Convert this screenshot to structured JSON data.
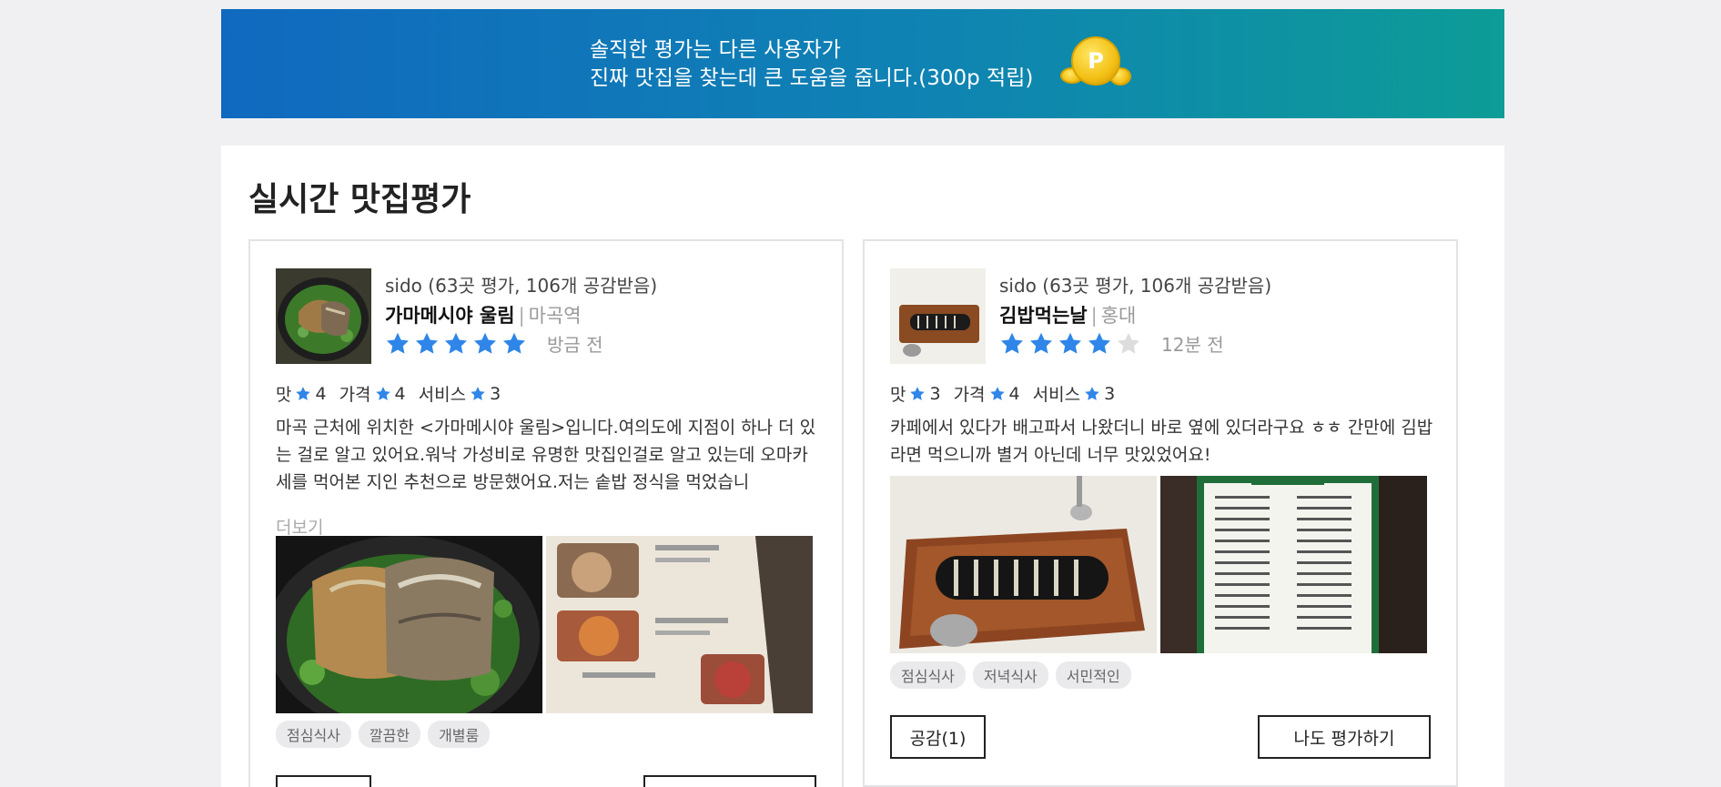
{
  "banner": {
    "line1": "솔직한 평가는 다른 사용자가",
    "line2": "진짜 맛집을 찾는데 큰 도움을 줍니다.(300p 적립)",
    "coin_label": "P"
  },
  "section": {
    "title": "실시간 맛집평가"
  },
  "reviews": [
    {
      "user": "sido (63곳 평가, 106개 공감받음)",
      "place": "가마메시야 울림",
      "location": "마곡역",
      "stars": 5,
      "time": "방금 전",
      "ratings": [
        {
          "label": "맛",
          "value": "4"
        },
        {
          "label": "가격",
          "value": "4"
        },
        {
          "label": "서비스",
          "value": "3"
        }
      ],
      "text": "마곡 근처에 위치한 <가마메시야 울림>입니다.여의도에 지점이 하나 더 있는 걸로 알고 있어요.워낙 가성비로 유명한 맛집인걸로 알고 있는데 오마카세를 먹어본 지인 추천으로 방문했어요.저는 솥밥 정식을 먹었습니",
      "more": "더보기",
      "tags": [
        "점심식사",
        "깔끔한",
        "개별룸"
      ]
    },
    {
      "user": "sido (63곳 평가, 106개 공감받음)",
      "place": "김밥먹는날",
      "location": "홍대",
      "stars": 4,
      "time": "12분 전",
      "ratings": [
        {
          "label": "맛",
          "value": "3"
        },
        {
          "label": "가격",
          "value": "4"
        },
        {
          "label": "서비스",
          "value": "3"
        }
      ],
      "text": "카페에서 있다가 배고파서 나왔더니 바로 옆에 있더라구요 ㅎㅎ 간만에 김밥 라면 먹으니까 별거 아닌데 너무 맛있었어요!",
      "tags": [
        "점심식사",
        "저녁식사",
        "서민적인"
      ],
      "like_label": "공감(1)",
      "rate_label": "나도 평가하기"
    }
  ],
  "colors": {
    "star": "#2f86e8",
    "star_empty": "#dddddd",
    "banner_start": "#1069bf",
    "banner_end": "#0d9c97"
  }
}
